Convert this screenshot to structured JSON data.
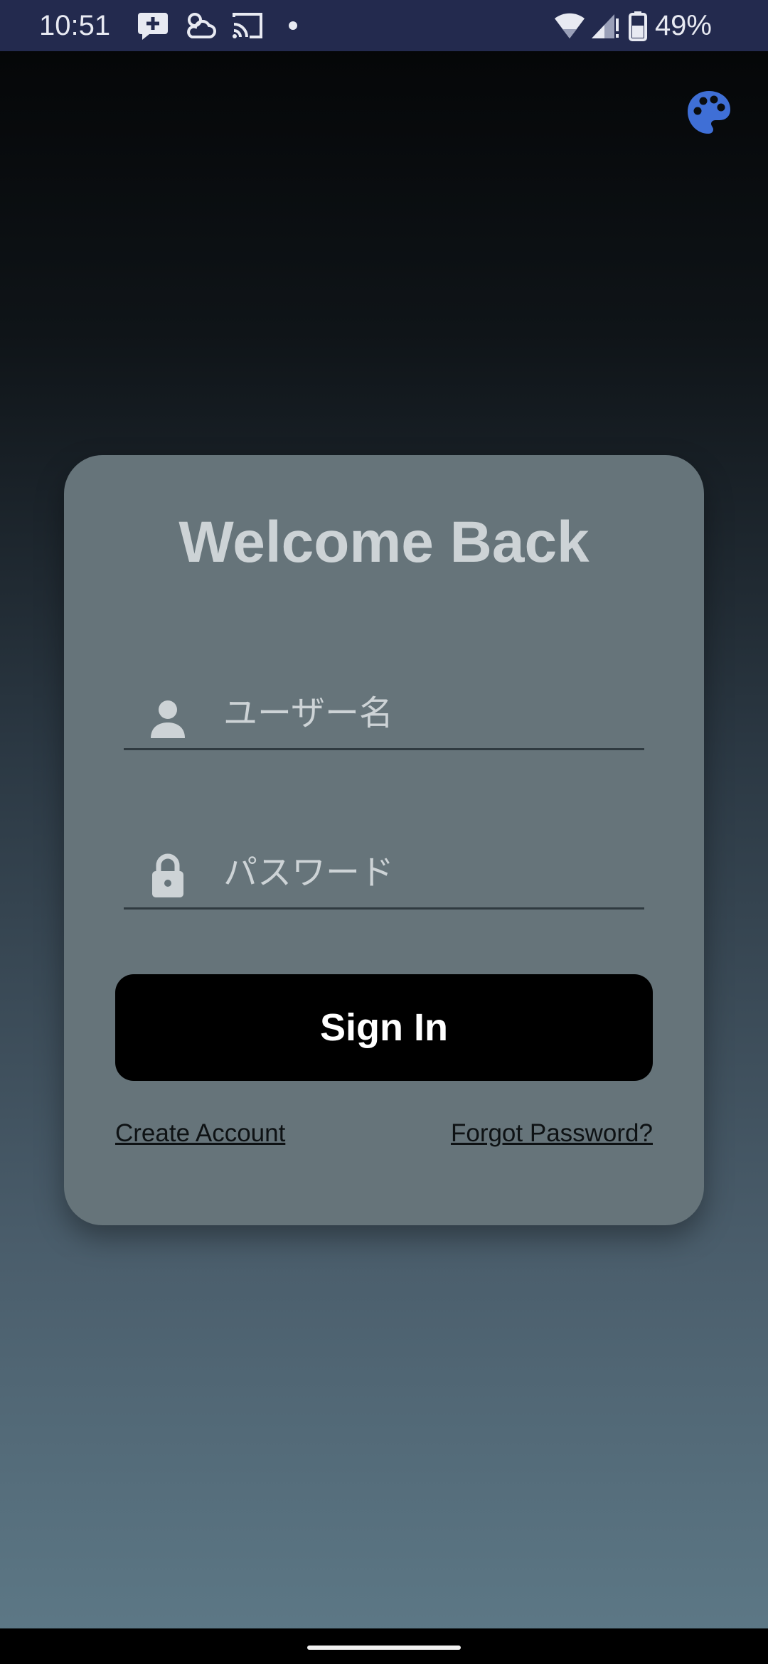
{
  "status_bar": {
    "time": "10:51",
    "battery_text": "49%",
    "icons": [
      "chat-plus-icon",
      "cloud-sun-icon",
      "cast-icon",
      "dot-icon",
      "wifi-icon",
      "signal-icon",
      "battery-icon"
    ]
  },
  "theme": {
    "palette_icon": "palette-icon",
    "palette_color": "#3f6fd6"
  },
  "login": {
    "title": "Welcome Back",
    "username_placeholder": "ユーザー名",
    "password_placeholder": "パスワード",
    "sign_in_label": "Sign In",
    "create_account_label": "Create Account",
    "forgot_password_label": "Forgot Password?"
  },
  "colors": {
    "card": "#66747a",
    "button": "#000000",
    "status_bar": "#232a4e"
  }
}
